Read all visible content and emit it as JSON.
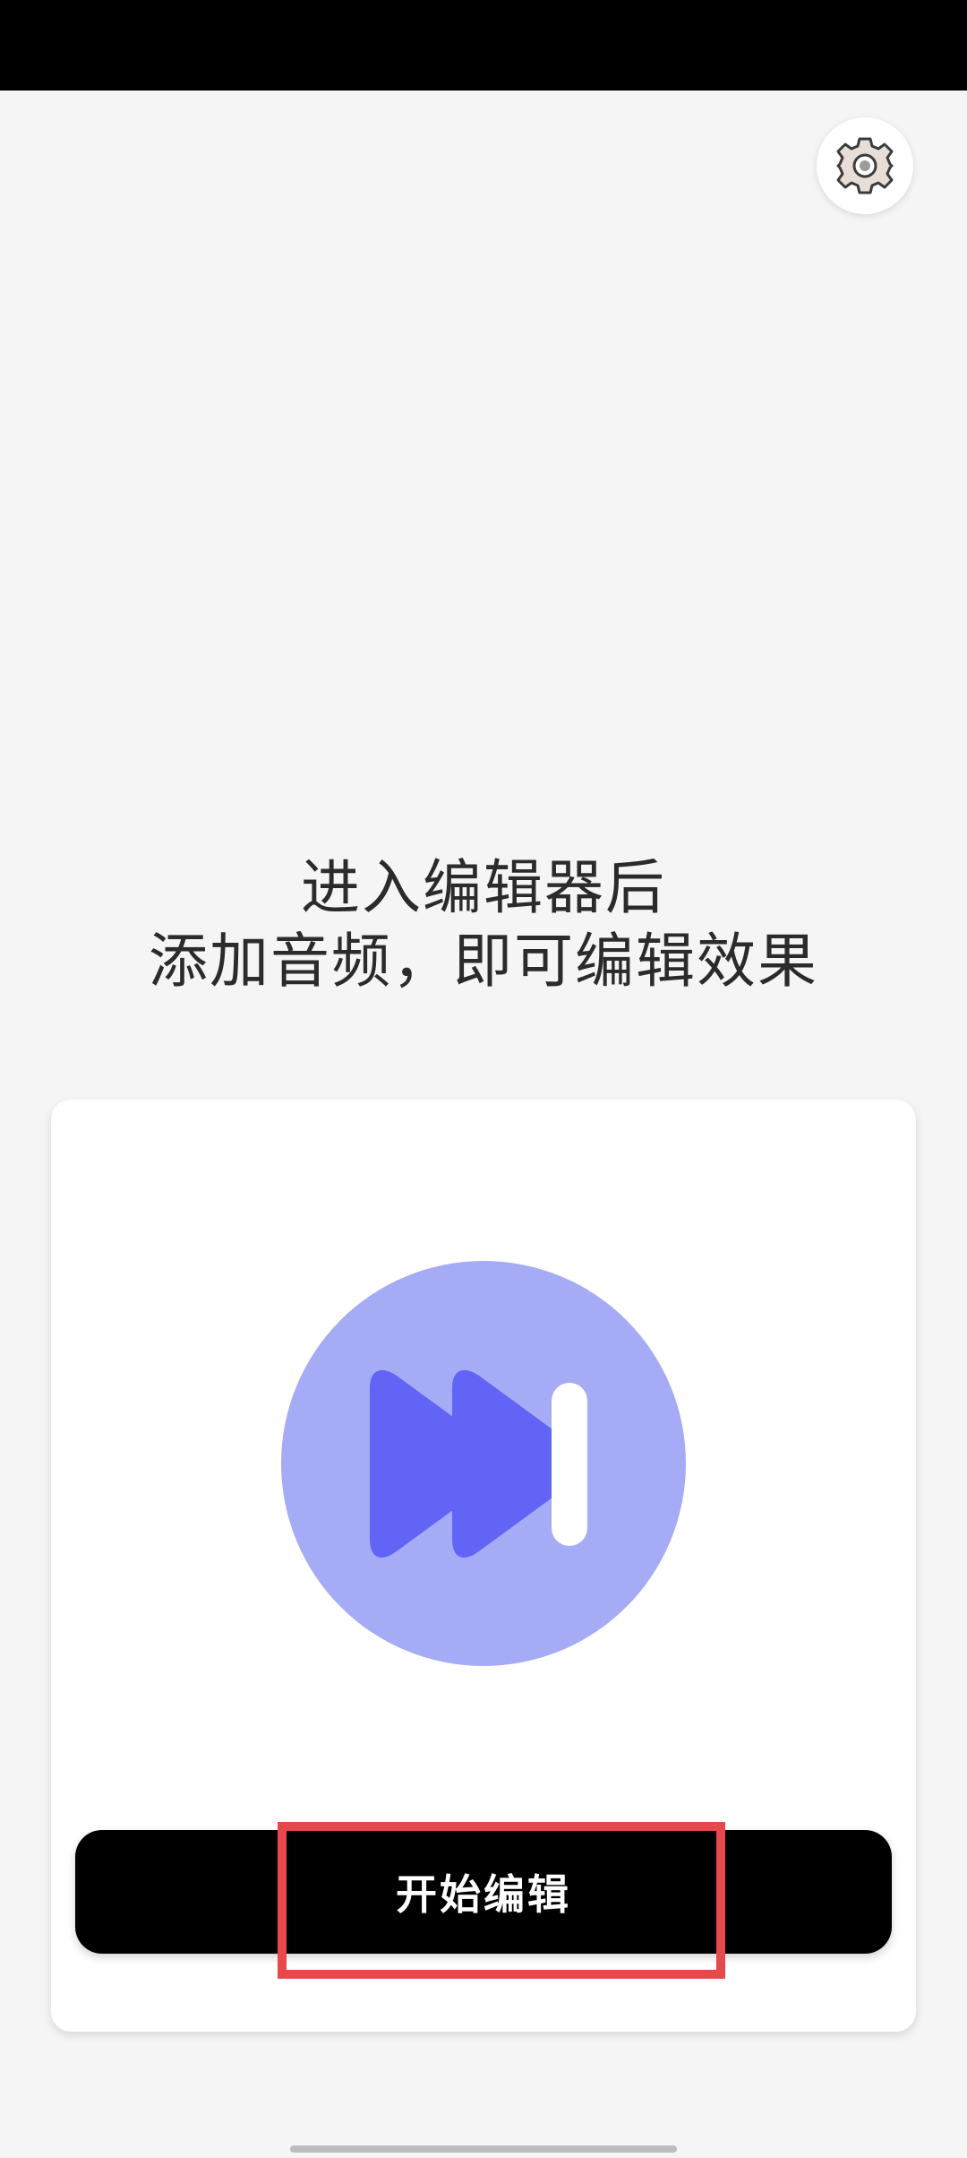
{
  "headline": {
    "line1": "进入编辑器后",
    "line2": "添加音频，即可编辑效果"
  },
  "card": {
    "start_button_label": "开始编辑"
  },
  "icons": {
    "settings": "gear-icon",
    "media": "skip-forward-icon"
  },
  "colors": {
    "background": "#f5f5f5",
    "circle": "#a5acf5",
    "accent": "#6264f6",
    "button": "#000000",
    "highlight": "#e8474b"
  }
}
